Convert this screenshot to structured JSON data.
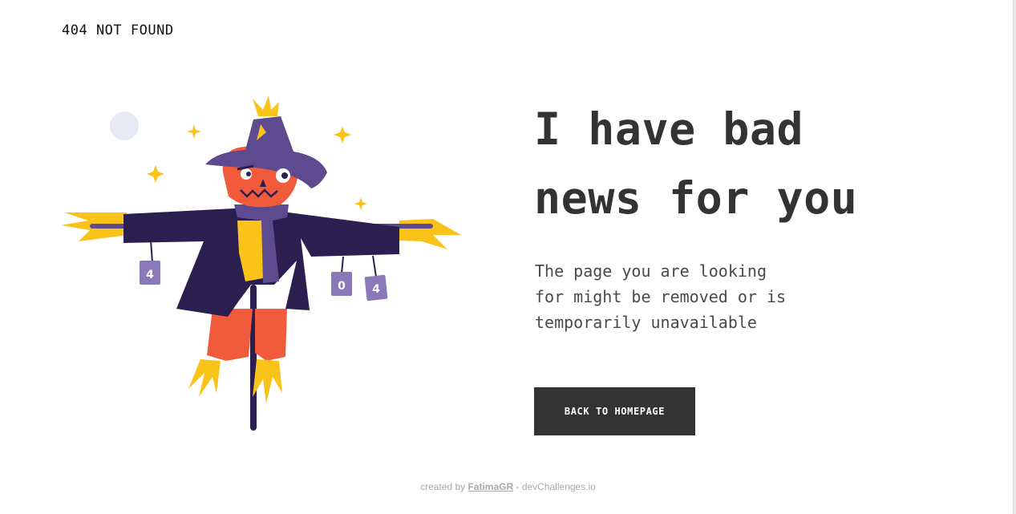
{
  "header": {
    "brand": "404 NOT FOUND"
  },
  "main": {
    "headline_line1": "I have bad",
    "headline_line2": "news for you",
    "message_line1": "The page you are looking",
    "message_line2": "for might be removed or is",
    "message_line3": "temporarily unavailable",
    "button_label": "BACK TO HOMEPAGE"
  },
  "illustration": {
    "can_labels": [
      "4",
      "0",
      "4"
    ]
  },
  "footer": {
    "prefix": "created by ",
    "author": "FatimaGR",
    "suffix": " - devChallenges.io"
  },
  "colors": {
    "text": "#333333",
    "button_bg": "#333333",
    "button_text": "#ffffff",
    "hat": "#5e4a8e",
    "coat": "#2a1f4f",
    "head": "#f25a3c",
    "straw": "#f9c31a"
  }
}
